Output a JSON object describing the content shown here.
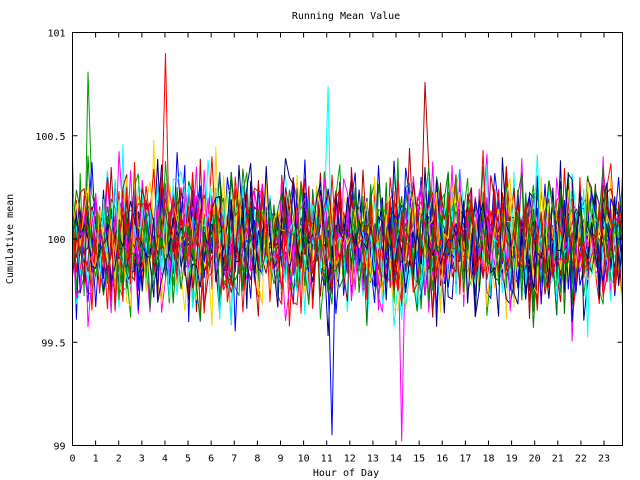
{
  "chart_data": {
    "type": "line",
    "title": "Running Mean Value",
    "xlabel": "Hour of Day",
    "ylabel": "Cumulative mean",
    "xlim": [
      0,
      23.8
    ],
    "ylim": [
      99,
      101
    ],
    "x_ticks": [
      "0",
      "1",
      "2",
      "3",
      "4",
      "5",
      "6",
      "7",
      "8",
      "9",
      "10",
      "11",
      "12",
      "13",
      "14",
      "15",
      "16",
      "17",
      "18",
      "19",
      "20",
      "21",
      "22",
      "23"
    ],
    "y_ticks": [
      "99",
      "99.5",
      "100",
      "100.5",
      "101"
    ],
    "grid": false,
    "legend": "none",
    "series_colors": [
      "#ff0000",
      "#00a000",
      "#0000ff",
      "#ff00ff",
      "#00ffff",
      "#b00000",
      "#ffd000",
      "#000080",
      "#008000"
    ],
    "series_count": 28,
    "points_per_series": 143,
    "center_value": 100,
    "typical_range": [
      99.55,
      100.45
    ],
    "extremes": [
      {
        "x": 3.95,
        "y": 100.9
      },
      {
        "x": 0.75,
        "y": 100.81
      },
      {
        "x": 11.25,
        "y": 99.05
      },
      {
        "x": 14.3,
        "y": 99.02
      },
      {
        "x": 11.05,
        "y": 100.74
      },
      {
        "x": 15.2,
        "y": 100.76
      }
    ]
  }
}
